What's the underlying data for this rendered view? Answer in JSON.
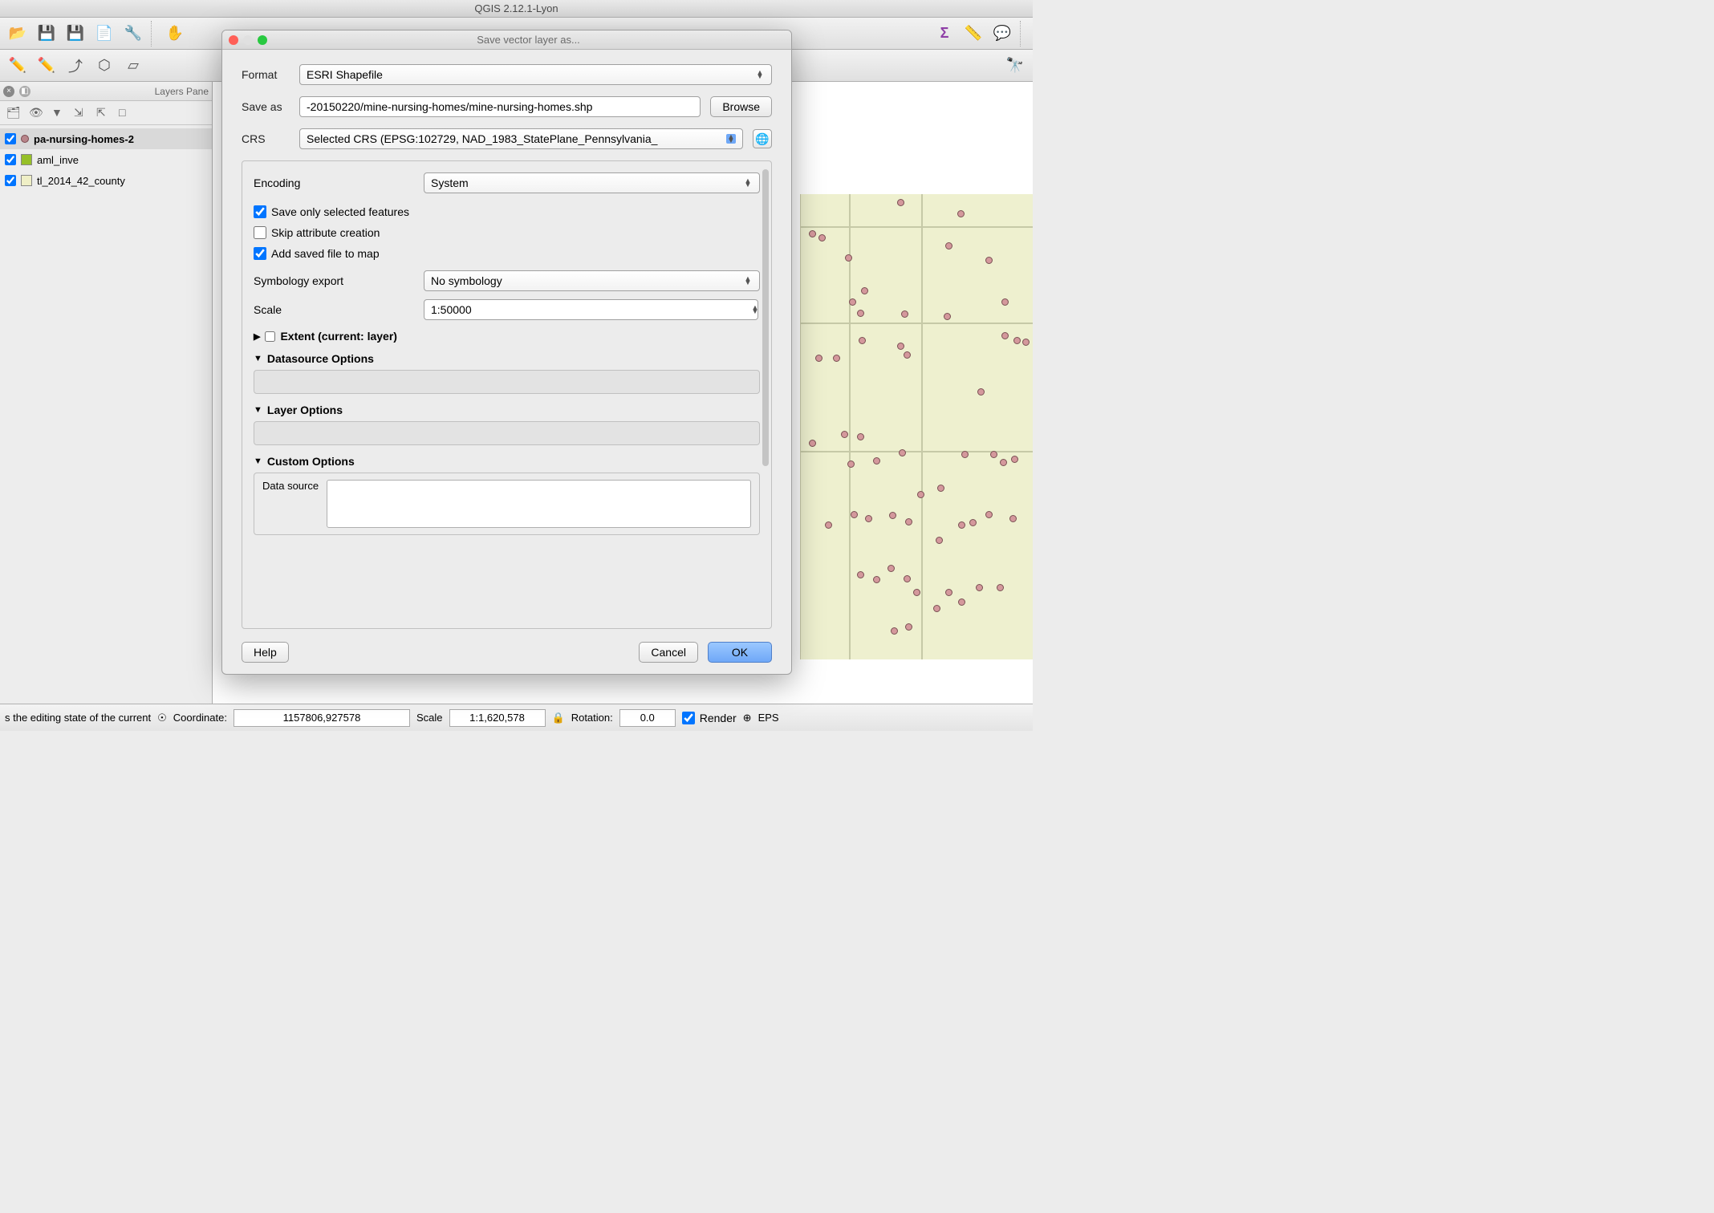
{
  "app": {
    "title": "QGIS 2.12.1-Lyon"
  },
  "panel": {
    "title": "Layers Pane"
  },
  "layers": [
    {
      "name": "pa-nursing-homes-2",
      "type": "point",
      "checked": true,
      "selected": true
    },
    {
      "name": "aml_inve",
      "type": "poly",
      "color": "#96c028",
      "checked": true,
      "selected": false
    },
    {
      "name": "tl_2014_42_county",
      "type": "poly",
      "color": "#efefc6",
      "checked": true,
      "selected": false
    }
  ],
  "status": {
    "hint": "s the editing state of the current",
    "coord_label": "Coordinate:",
    "coord": "1157806,927578",
    "scale_label": "Scale",
    "scale": "1:1,620,578",
    "rotation_label": "Rotation:",
    "rotation": "0.0",
    "render": "Render",
    "eps": "EPS"
  },
  "dialog": {
    "title": "Save vector layer as...",
    "format_label": "Format",
    "format": "ESRI Shapefile",
    "saveas_label": "Save as",
    "saveas": "-20150220/mine-nursing-homes/mine-nursing-homes.shp",
    "browse": "Browse",
    "crs_label": "CRS",
    "crs": "Selected CRS (EPSG:102729, NAD_1983_StatePlane_Pennsylvania_",
    "encoding_label": "Encoding",
    "encoding": "System",
    "save_selected": "Save only selected features",
    "skip_attr": "Skip attribute creation",
    "add_to_map": "Add saved file to map",
    "symbology_label": "Symbology export",
    "symbology": "No symbology",
    "scale_label": "Scale",
    "scale": "1:50000",
    "extent": "Extent (current: layer)",
    "datasource_opts": "Datasource Options",
    "layer_opts": "Layer Options",
    "custom_opts": "Custom Options",
    "data_source": "Data source",
    "help": "Help",
    "cancel": "Cancel",
    "ok": "OK"
  }
}
